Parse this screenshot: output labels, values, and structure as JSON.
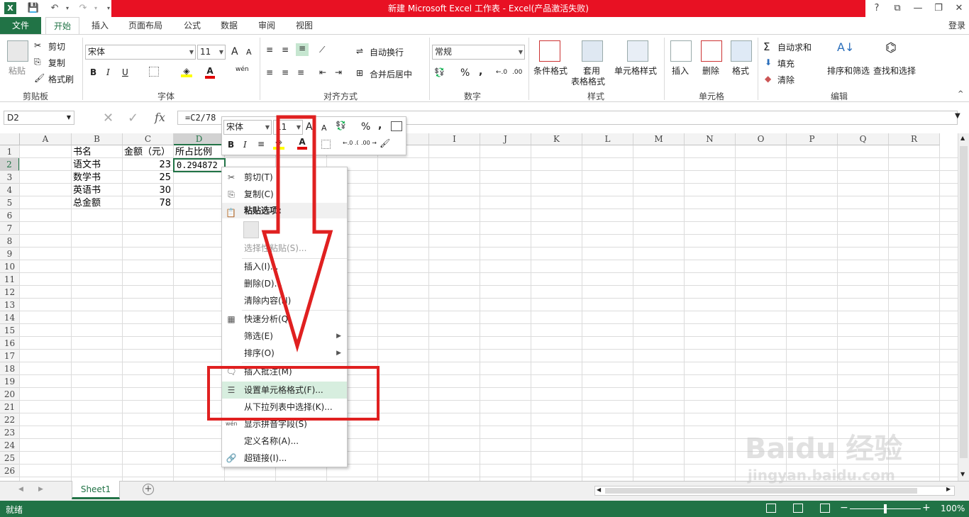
{
  "title": "新建 Microsoft Excel 工作表 -  Excel(产品激活失败)",
  "window_buttons": {
    "help": "?",
    "restore": "⧉",
    "minimize": "—",
    "maximize": "❐",
    "close": "✕"
  },
  "signin": "登录",
  "tabs": [
    "文件",
    "开始",
    "插入",
    "页面布局",
    "公式",
    "数据",
    "审阅",
    "视图"
  ],
  "ribbon": {
    "clipboard": {
      "paste": "粘贴",
      "cut": "剪切",
      "copy": "复制",
      "format_painter": "格式刷",
      "label": "剪贴板"
    },
    "font": {
      "name": "宋体",
      "size": "11",
      "label": "字体",
      "bold": "B",
      "italic": "I",
      "underline": "U",
      "grow": "A",
      "shrink": "A",
      "font_color": "A",
      "phonetic": "wén"
    },
    "align": {
      "wrap": "自动换行",
      "merge": "合并后居中",
      "label": "对齐方式"
    },
    "number": {
      "format": "常规",
      "percent": "%",
      "comma": ",",
      "label": "数字"
    },
    "styles": {
      "cond": "条件格式",
      "table1": "套用",
      "table2": "表格格式",
      "cell_style": "单元格样式",
      "label": "样式"
    },
    "cells": {
      "insert": "插入",
      "delete": "删除",
      "format": "格式",
      "label": "单元格"
    },
    "editing": {
      "autosum": "自动求和",
      "fill": "填充",
      "clear": "清除",
      "sort": "排序和筛选",
      "find": "查找和选择",
      "label": "编辑"
    }
  },
  "namebox": "D2",
  "fx": "fx",
  "formula": "=C2/78",
  "columns": [
    "A",
    "B",
    "C",
    "D",
    "E",
    "F",
    "G",
    "H",
    "I",
    "J",
    "K",
    "L",
    "M",
    "N",
    "O",
    "P",
    "Q",
    "R"
  ],
  "rows": [
    "1",
    "2",
    "3",
    "4",
    "5",
    "6",
    "7",
    "8",
    "9",
    "10",
    "11",
    "12",
    "13",
    "14",
    "15",
    "16",
    "17",
    "18",
    "19",
    "20",
    "21",
    "22",
    "23",
    "24",
    "25",
    "26"
  ],
  "cells": {
    "b1": "书名",
    "c1": "金额（元）",
    "d1": "所占比例",
    "b2": "语文书",
    "c2": "23",
    "d2": "0.294872",
    "b3": "数学书",
    "c3": "25",
    "b4": "英语书",
    "c4": "30",
    "b5": "总金额",
    "c5": "78"
  },
  "mini_toolbar": {
    "font": "宋体",
    "size": "11",
    "percent": "%",
    "comma": ",",
    "bold": "B",
    "italic": "I",
    "dec_inc": "←.0 .00",
    "dec_dec": ".00 →.0"
  },
  "context_menu": {
    "cut": "剪切(T)",
    "copy": "复制(C)",
    "paste_header": "粘贴选项:",
    "paste_special": "选择性粘贴(S)...",
    "insert": "插入(I)...",
    "delete": "删除(D)...",
    "clear": "清除内容(N)",
    "quick_analysis": "快速分析(Q)",
    "filter": "筛选(E)",
    "sort": "排序(O)",
    "insert_comment": "插入批注(M)",
    "format_cells": "设置单元格格式(F)...",
    "pick_list": "从下拉列表中选择(K)...",
    "phonetic": "显示拼音字段(S)",
    "define_name": "定义名称(A)...",
    "hyperlink": "超链接(I)..."
  },
  "sheet_tab": "Sheet1",
  "add_sheet": "+",
  "status": {
    "ready": "就绪",
    "zoom": "100%"
  },
  "watermark": {
    "brand": "Baidu 经验",
    "url": "jingyan.baidu.com"
  },
  "colors": {
    "excel_green": "#217346",
    "title_red": "#e81123",
    "annotation_red": "#e02020"
  }
}
